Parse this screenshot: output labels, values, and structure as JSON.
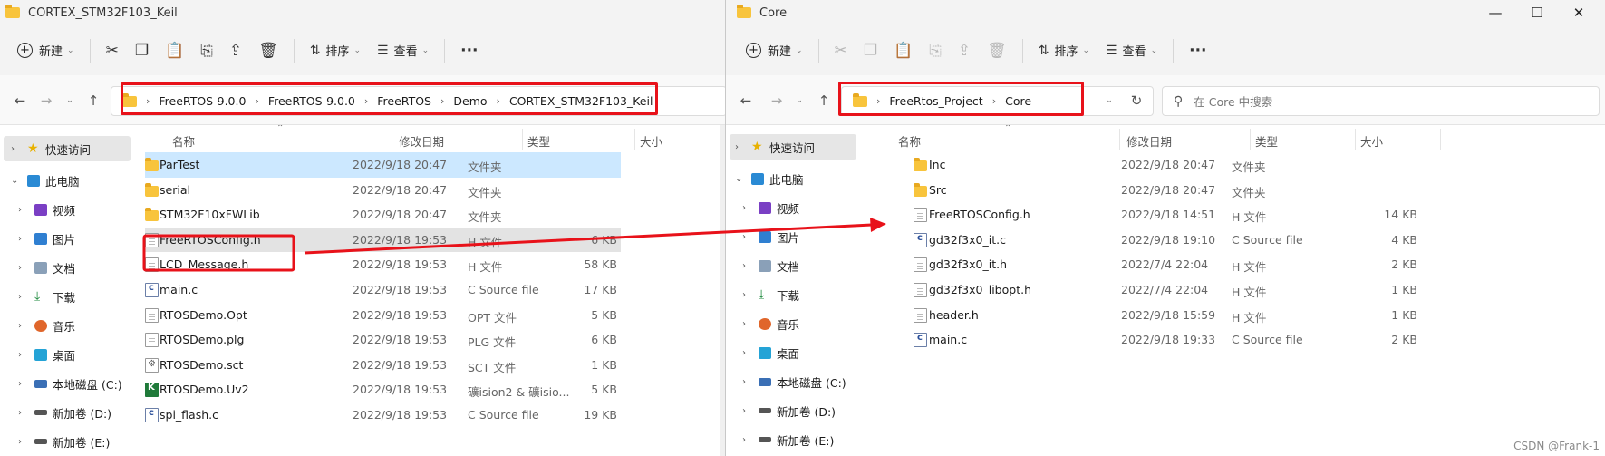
{
  "left": {
    "title": "CORTEX_STM32F103_Keil",
    "toolbar": {
      "new": "新建",
      "sort": "排序",
      "view": "查看",
      "more": "···"
    },
    "breadcrumb": [
      "FreeRTOS-9.0.0",
      "FreeRTOS-9.0.0",
      "FreeRTOS",
      "Demo",
      "CORTEX_STM32F103_Keil"
    ],
    "columns": {
      "name": "名称",
      "date": "修改日期",
      "type": "类型",
      "size": "大小"
    },
    "files": [
      {
        "name": "ParTest",
        "date": "2022/9/18 20:47",
        "type": "文件夹",
        "size": "",
        "icon": "folder-icon"
      },
      {
        "name": "serial",
        "date": "2022/9/18 20:47",
        "type": "文件夹",
        "size": "",
        "icon": "folder-icon"
      },
      {
        "name": "STM32F10xFWLib",
        "date": "2022/9/18 20:47",
        "type": "文件夹",
        "size": "",
        "icon": "folder-icon"
      },
      {
        "name": "FreeRTOSConfig.h",
        "date": "2022/9/18 19:53",
        "type": "H 文件",
        "size": "6 KB",
        "icon": "header-file-icon"
      },
      {
        "name": "LCD_Message.h",
        "date": "2022/9/18 19:53",
        "type": "H 文件",
        "size": "58 KB",
        "icon": "header-file-icon"
      },
      {
        "name": "main.c",
        "date": "2022/9/18 19:53",
        "type": "C Source file",
        "size": "17 KB",
        "icon": "c-file-icon"
      },
      {
        "name": "RTOSDemo.Opt",
        "date": "2022/9/18 19:53",
        "type": "OPT 文件",
        "size": "5 KB",
        "icon": "file-icon"
      },
      {
        "name": "RTOSDemo.plg",
        "date": "2022/9/18 19:53",
        "type": "PLG 文件",
        "size": "6 KB",
        "icon": "file-icon"
      },
      {
        "name": "RTOSDemo.sct",
        "date": "2022/9/18 19:53",
        "type": "SCT 文件",
        "size": "1 KB",
        "icon": "settings-file-icon"
      },
      {
        "name": "RTOSDemo.Uv2",
        "date": "2022/9/18 19:53",
        "type": "礦ision2 & 礦isio...",
        "size": "5 KB",
        "icon": "keil-project-icon"
      },
      {
        "name": "spi_flash.c",
        "date": "2022/9/18 19:53",
        "type": "C Source file",
        "size": "19 KB",
        "icon": "c-file-icon"
      }
    ]
  },
  "right": {
    "title": "Core",
    "toolbar": {
      "new": "新建",
      "sort": "排序",
      "view": "查看",
      "more": "···"
    },
    "breadcrumb": [
      "FreeRtos_Project",
      "Core"
    ],
    "search_placeholder": "在 Core 中搜索",
    "window_controls": {
      "minimize": "—",
      "maximize": "☐",
      "close": "✕"
    },
    "columns": {
      "name": "名称",
      "date": "修改日期",
      "type": "类型",
      "size": "大小"
    },
    "files": [
      {
        "name": "Inc",
        "date": "2022/9/18 20:47",
        "type": "文件夹",
        "size": "",
        "icon": "folder-icon"
      },
      {
        "name": "Src",
        "date": "2022/9/18 20:47",
        "type": "文件夹",
        "size": "",
        "icon": "folder-icon"
      },
      {
        "name": "FreeRTOSConfig.h",
        "date": "2022/9/18 14:51",
        "type": "H 文件",
        "size": "14 KB",
        "icon": "header-file-icon"
      },
      {
        "name": "gd32f3x0_it.c",
        "date": "2022/9/18 19:10",
        "type": "C Source file",
        "size": "4 KB",
        "icon": "c-file-icon"
      },
      {
        "name": "gd32f3x0_it.h",
        "date": "2022/7/4 22:04",
        "type": "H 文件",
        "size": "2 KB",
        "icon": "header-file-icon"
      },
      {
        "name": "gd32f3x0_libopt.h",
        "date": "2022/7/4 22:04",
        "type": "H 文件",
        "size": "1 KB",
        "icon": "header-file-icon"
      },
      {
        "name": "header.h",
        "date": "2022/9/18 15:59",
        "type": "H 文件",
        "size": "1 KB",
        "icon": "header-file-icon"
      },
      {
        "name": "main.c",
        "date": "2022/9/18 19:33",
        "type": "C Source file",
        "size": "2 KB",
        "icon": "c-file-icon"
      }
    ]
  },
  "sidebar": [
    {
      "label": "快速访问",
      "icon": "star-icon"
    },
    {
      "label": "此电脑",
      "icon": "computer-icon"
    },
    {
      "label": "视频",
      "icon": "video-icon"
    },
    {
      "label": "图片",
      "icon": "pictures-icon"
    },
    {
      "label": "文档",
      "icon": "documents-icon"
    },
    {
      "label": "下载",
      "icon": "download-icon"
    },
    {
      "label": "音乐",
      "icon": "music-icon"
    },
    {
      "label": "桌面",
      "icon": "desktop-icon"
    },
    {
      "label": "本地磁盘 (C:)",
      "icon": "drive-icon"
    },
    {
      "label": "新加卷 (D:)",
      "icon": "drive-icon"
    },
    {
      "label": "新加卷 (E:)",
      "icon": "drive-icon"
    }
  ],
  "colors": {
    "accent_red": "#e8121a",
    "selection": "#cce8ff",
    "folder": "#f8c43c"
  },
  "watermark": "CSDN @Frank-1"
}
